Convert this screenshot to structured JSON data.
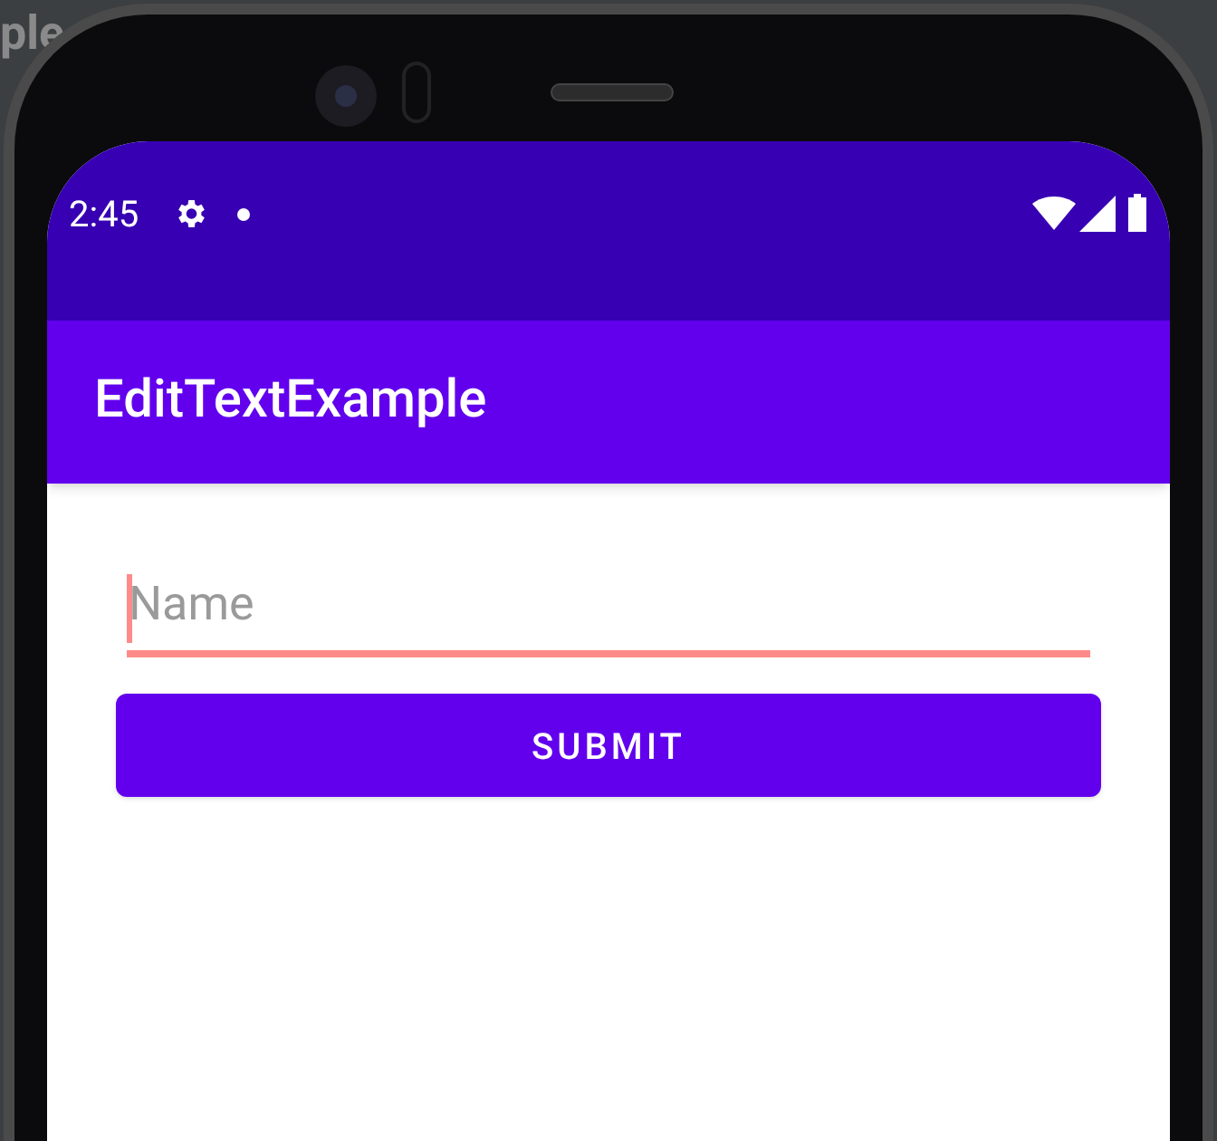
{
  "background_text": "ple",
  "status_bar": {
    "time": "2:45"
  },
  "app_bar": {
    "title": "EditTextExample"
  },
  "name_field": {
    "placeholder": "Name",
    "focused": true
  },
  "submit_button": {
    "label": "SUBMIT"
  }
}
